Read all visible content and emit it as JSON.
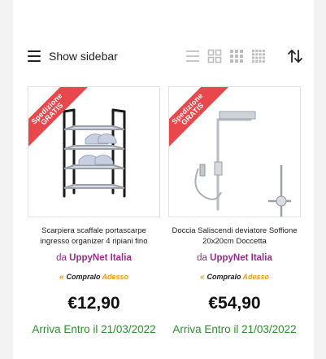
{
  "toolbar": {
    "sidebar_label": "Show sidebar",
    "icons": [
      "hamburger-icon",
      "list-view-icon",
      "grid-2-icon",
      "grid-3-icon",
      "grid-4-icon",
      "sort-icon"
    ]
  },
  "products": [
    {
      "badge_line1": "Spedizione",
      "badge_line2": "GRATIS",
      "title": "Scarpiera scaffale portascarpe ingresso organizer 4 ripiani fino",
      "seller_prefix": "da",
      "seller_name": "UppyNet Italia",
      "buy_word1": "Compralo",
      "buy_word2": "Adesso",
      "price": "€12,90",
      "delivery": "Arriva Entro il 21/03/2022"
    },
    {
      "badge_line1": "Spedizione",
      "badge_line2": "GRATIS",
      "title": "Doccia Saliscendi deviatore Soffione 20x20cm Doccetta",
      "seller_prefix": "da",
      "seller_name": "UppyNet Italia",
      "buy_word1": "Compralo",
      "buy_word2": "Adesso",
      "price": "€54,90",
      "delivery": "Arriva Entro il 21/03/2022"
    }
  ],
  "colors": {
    "seller": "#9b2c8e",
    "delivery": "#2d8f2d",
    "ribbon": "#e8474c",
    "buy_accent": "#f29b10"
  }
}
